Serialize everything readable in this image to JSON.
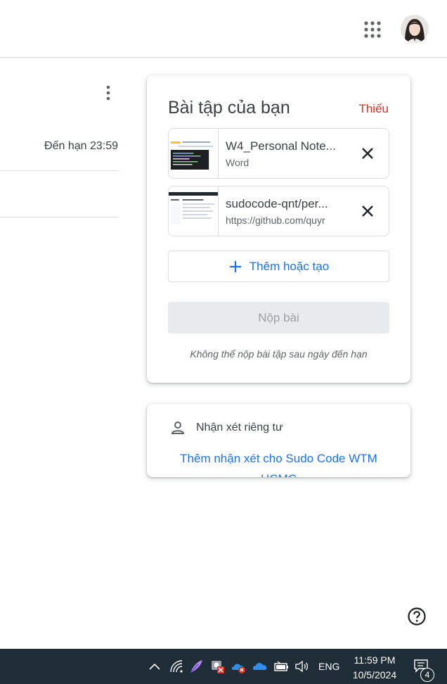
{
  "header": {
    "apps_icon": "apps-grid-icon",
    "avatar": "user-avatar"
  },
  "assignment": {
    "due_text": "Đến hạn 23:59"
  },
  "your_work": {
    "title": "Bài tập của bạn",
    "status": "Thiếu",
    "status_color": "#d93025",
    "attachments": [
      {
        "name": "W4_Personal Note...",
        "subtitle": "Word"
      },
      {
        "name": "sudocode-qnt/per...",
        "subtitle": "https://github.com/quyr"
      }
    ],
    "add_label": "Thêm hoặc tạo",
    "submit_label": "Nộp bài",
    "late_note": "Không thể nộp bài tập sau ngày đến hạn"
  },
  "private_comments": {
    "title": "Nhận xét riêng tư",
    "add_label": "Thêm nhận xét cho Sudo Code WTM HCMC"
  },
  "taskbar": {
    "language": "ENG",
    "time": "11:59 PM",
    "date": "10/5/2024",
    "notification_count": "4"
  },
  "colors": {
    "accent": "#1a73e8",
    "taskbar": "#1f2d36"
  }
}
